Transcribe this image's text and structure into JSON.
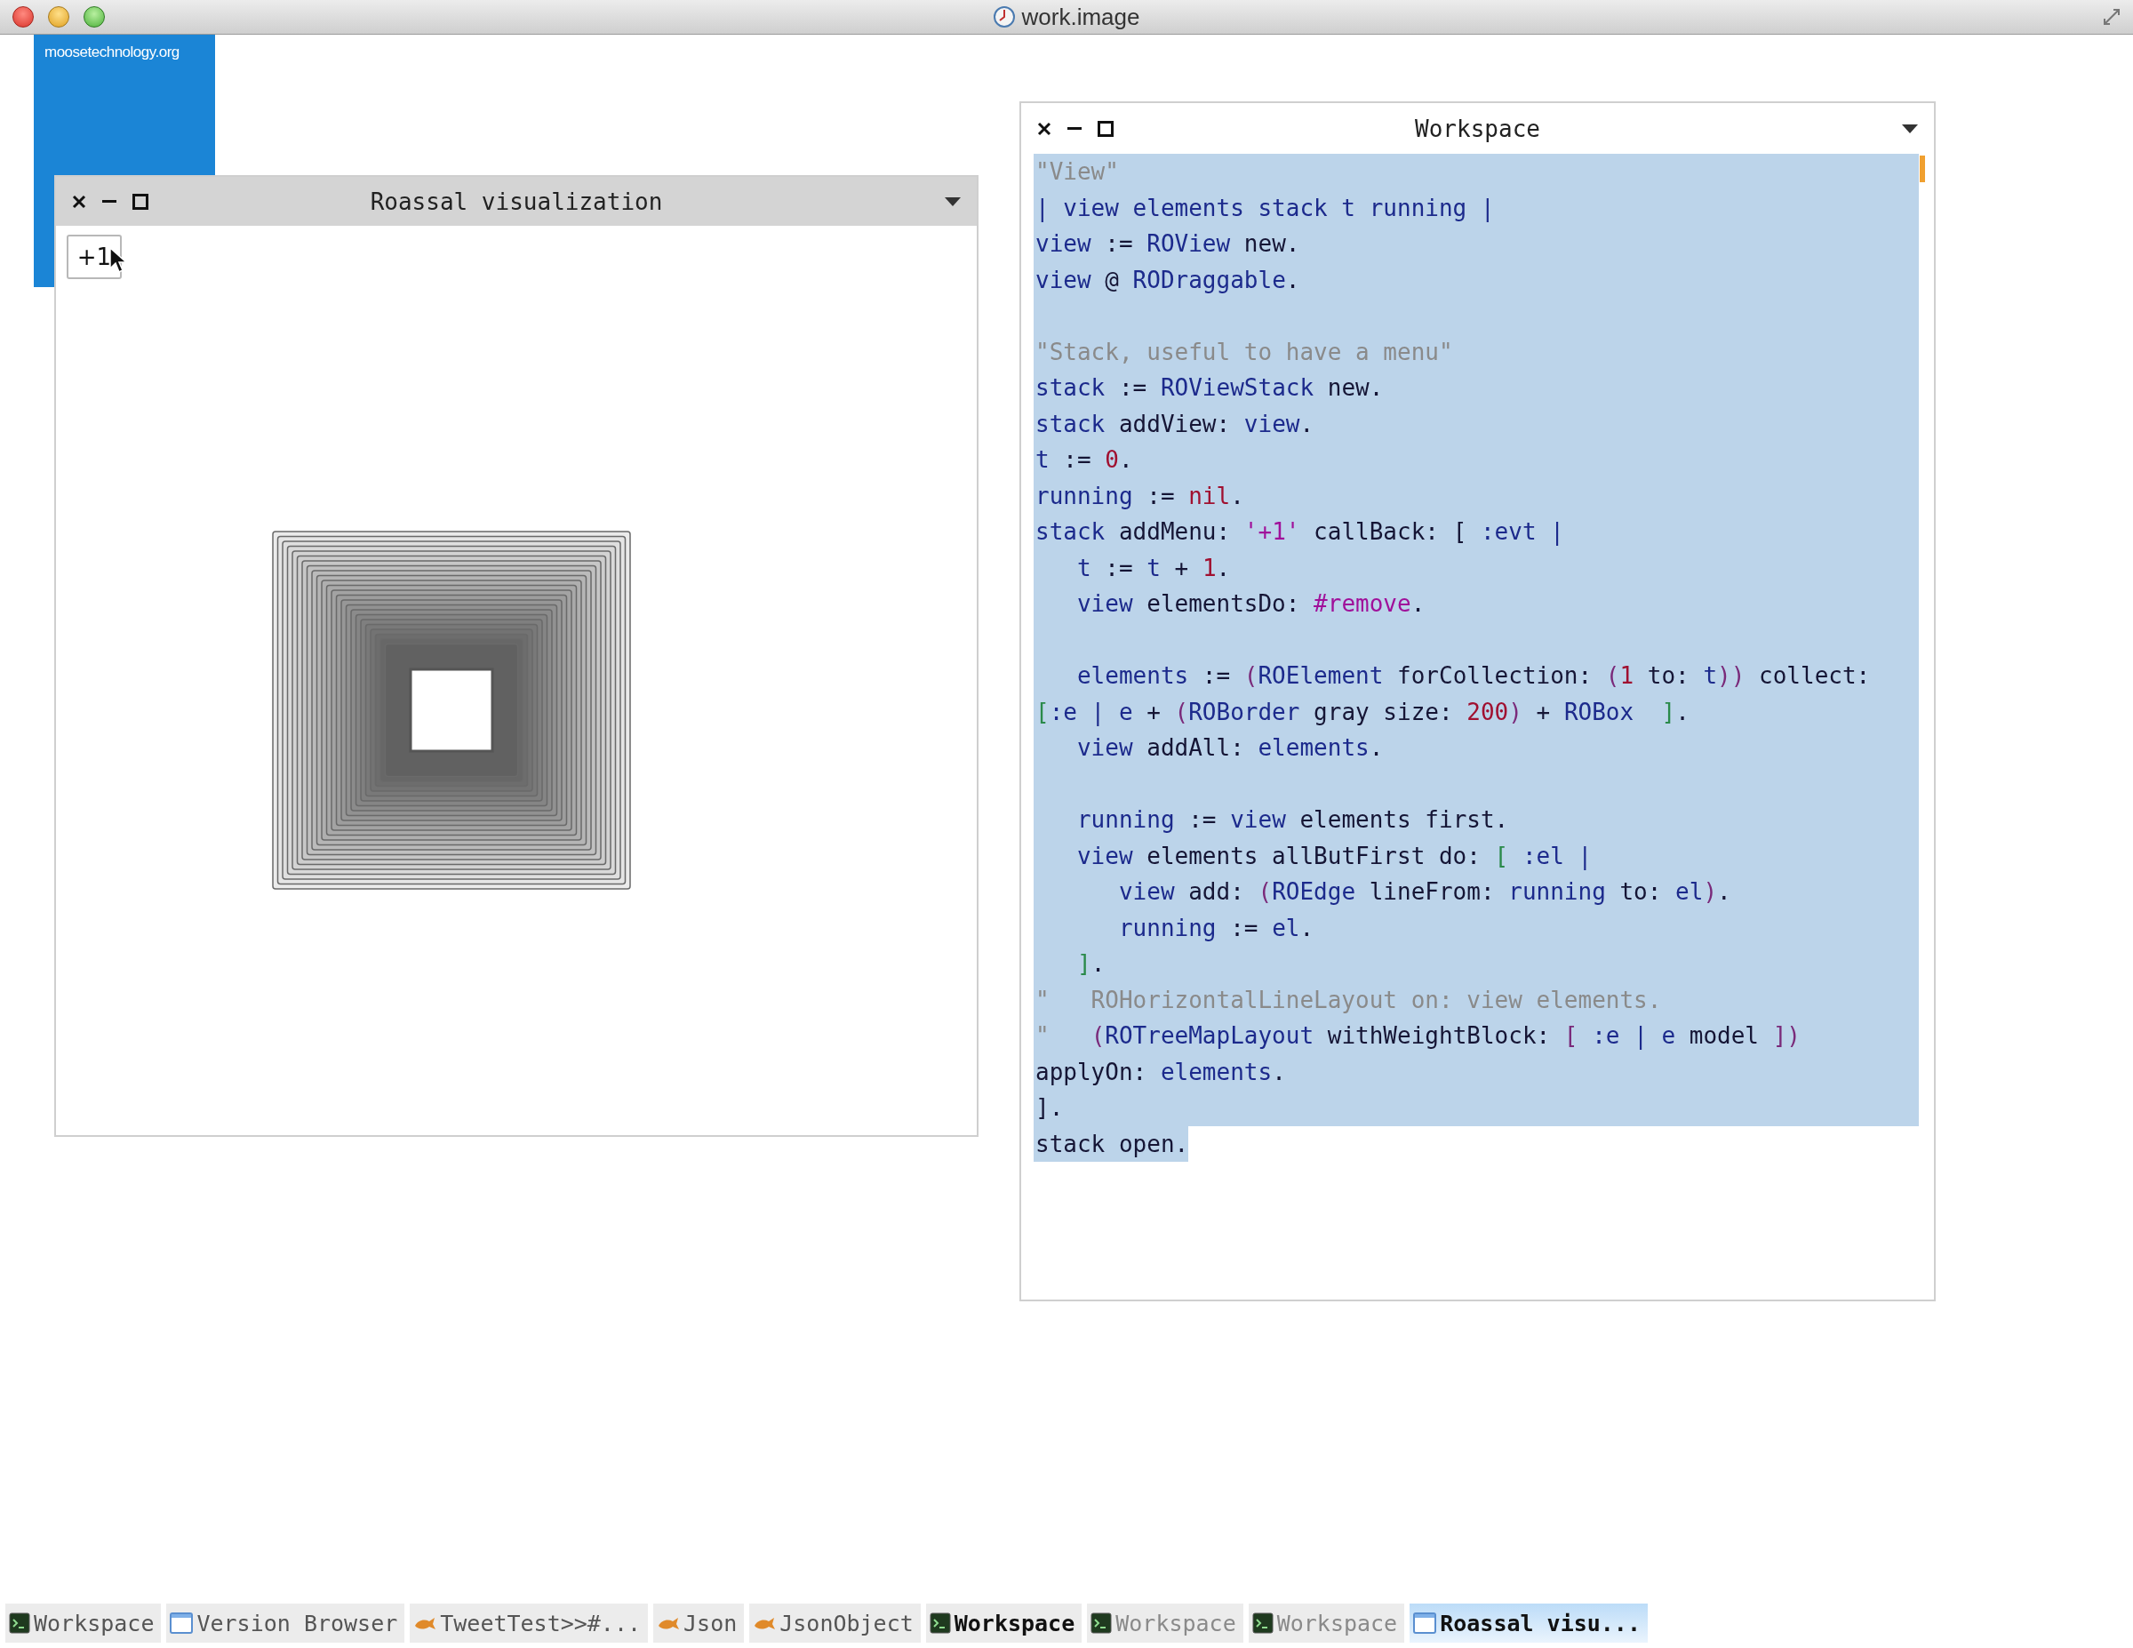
{
  "title_bar": {
    "title": "work.image"
  },
  "desktop_badge": {
    "text": "moosetechnology.org"
  },
  "roassal_window": {
    "title": "Roassal visualization",
    "menu_button": "+1"
  },
  "workspace_window": {
    "title": "Workspace",
    "lines": [
      {
        "selected": true,
        "segments": [
          {
            "kind": "comment",
            "text": "\"View\""
          }
        ]
      },
      {
        "selected": true,
        "segments": [
          {
            "kind": "var",
            "text": "| view elements stack t running |"
          }
        ]
      },
      {
        "selected": true,
        "segments": [
          {
            "kind": "var",
            "text": "view"
          },
          {
            "kind": "plain",
            "text": " := "
          },
          {
            "kind": "var",
            "text": "ROView"
          },
          {
            "kind": "plain",
            "text": " new."
          }
        ]
      },
      {
        "selected": true,
        "segments": [
          {
            "kind": "var",
            "text": "view"
          },
          {
            "kind": "plain",
            "text": " @ "
          },
          {
            "kind": "var",
            "text": "RODraggable"
          },
          {
            "kind": "plain",
            "text": "."
          }
        ]
      },
      {
        "selected": true,
        "gap_before": true,
        "segments": [
          {
            "kind": "comment",
            "text": "\"Stack, useful to have a menu\""
          }
        ]
      },
      {
        "selected": true,
        "segments": [
          {
            "kind": "var",
            "text": "stack"
          },
          {
            "kind": "plain",
            "text": " := "
          },
          {
            "kind": "var",
            "text": "ROViewStack"
          },
          {
            "kind": "plain",
            "text": " new."
          }
        ]
      },
      {
        "selected": true,
        "segments": [
          {
            "kind": "var",
            "text": "stack"
          },
          {
            "kind": "plain",
            "text": " addView: "
          },
          {
            "kind": "var",
            "text": "view"
          },
          {
            "kind": "plain",
            "text": "."
          }
        ]
      },
      {
        "selected": true,
        "segments": [
          {
            "kind": "var",
            "text": "t"
          },
          {
            "kind": "plain",
            "text": " := "
          },
          {
            "kind": "number",
            "text": "0"
          },
          {
            "kind": "plain",
            "text": "."
          }
        ]
      },
      {
        "selected": true,
        "segments": [
          {
            "kind": "var",
            "text": "running"
          },
          {
            "kind": "plain",
            "text": " := "
          },
          {
            "kind": "number",
            "text": "nil"
          },
          {
            "kind": "plain",
            "text": "."
          }
        ]
      },
      {
        "selected": true,
        "segments": [
          {
            "kind": "var",
            "text": "stack"
          },
          {
            "kind": "plain",
            "text": " addMenu: "
          },
          {
            "kind": "symbol",
            "text": "'+1'"
          },
          {
            "kind": "plain",
            "text": " callBack: [ "
          },
          {
            "kind": "var",
            "text": ":evt |"
          }
        ]
      },
      {
        "selected": true,
        "segments": [
          {
            "kind": "var",
            "text": "   t"
          },
          {
            "kind": "plain",
            "text": " := "
          },
          {
            "kind": "var",
            "text": "t"
          },
          {
            "kind": "plain",
            "text": " + "
          },
          {
            "kind": "number",
            "text": "1"
          },
          {
            "kind": "plain",
            "text": "."
          }
        ]
      },
      {
        "selected": true,
        "segments": [
          {
            "kind": "var",
            "text": "   view"
          },
          {
            "kind": "plain",
            "text": " elementsDo: "
          },
          {
            "kind": "symbol",
            "text": "#remove"
          },
          {
            "kind": "plain",
            "text": "."
          }
        ]
      },
      {
        "selected": true,
        "gap_before": true,
        "segments": [
          {
            "kind": "var",
            "text": "   elements"
          },
          {
            "kind": "plain",
            "text": " := "
          },
          {
            "kind": "paren",
            "text": "("
          },
          {
            "kind": "var",
            "text": "ROElement"
          },
          {
            "kind": "plain",
            "text": " forCollection: "
          },
          {
            "kind": "paren",
            "text": "("
          },
          {
            "kind": "number",
            "text": "1"
          },
          {
            "kind": "plain",
            "text": " to: "
          },
          {
            "kind": "var",
            "text": "t"
          },
          {
            "kind": "paren",
            "text": "))"
          },
          {
            "kind": "plain",
            "text": " collect:"
          }
        ]
      },
      {
        "selected": true,
        "segments": [
          {
            "kind": "bracket",
            "text": "["
          },
          {
            "kind": "var",
            "text": ":e | e"
          },
          {
            "kind": "plain",
            "text": " + "
          },
          {
            "kind": "paren",
            "text": "("
          },
          {
            "kind": "var",
            "text": "ROBorder"
          },
          {
            "kind": "plain",
            "text": " gray size: "
          },
          {
            "kind": "number",
            "text": "200"
          },
          {
            "kind": "paren",
            "text": ")"
          },
          {
            "kind": "plain",
            "text": " + "
          },
          {
            "kind": "var",
            "text": "ROBox"
          },
          {
            "kind": "bracket",
            "text": "  ]"
          },
          {
            "kind": "plain",
            "text": "."
          }
        ]
      },
      {
        "selected": true,
        "segments": [
          {
            "kind": "var",
            "text": "   view"
          },
          {
            "kind": "plain",
            "text": " addAll: "
          },
          {
            "kind": "var",
            "text": "elements"
          },
          {
            "kind": "plain",
            "text": "."
          }
        ]
      },
      {
        "selected": true,
        "gap_before": true,
        "segments": [
          {
            "kind": "var",
            "text": "   running"
          },
          {
            "kind": "plain",
            "text": " := "
          },
          {
            "kind": "var",
            "text": "view"
          },
          {
            "kind": "plain",
            "text": " elements first."
          }
        ]
      },
      {
        "selected": true,
        "segments": [
          {
            "kind": "var",
            "text": "   view"
          },
          {
            "kind": "plain",
            "text": " elements allButFirst do: "
          },
          {
            "kind": "bracket",
            "text": "["
          },
          {
            "kind": "var",
            "text": " :el |"
          }
        ]
      },
      {
        "selected": true,
        "segments": [
          {
            "kind": "var",
            "text": "      view"
          },
          {
            "kind": "plain",
            "text": " add: "
          },
          {
            "kind": "paren",
            "text": "("
          },
          {
            "kind": "var",
            "text": "ROEdge"
          },
          {
            "kind": "plain",
            "text": " lineFrom: "
          },
          {
            "kind": "var",
            "text": "running"
          },
          {
            "kind": "plain",
            "text": " to: "
          },
          {
            "kind": "var",
            "text": "el"
          },
          {
            "kind": "paren",
            "text": ")"
          },
          {
            "kind": "plain",
            "text": "."
          }
        ]
      },
      {
        "selected": true,
        "segments": [
          {
            "kind": "var",
            "text": "      running"
          },
          {
            "kind": "plain",
            "text": " := "
          },
          {
            "kind": "var",
            "text": "el"
          },
          {
            "kind": "plain",
            "text": "."
          }
        ]
      },
      {
        "selected": true,
        "segments": [
          {
            "kind": "bracket",
            "text": "   ]"
          },
          {
            "kind": "plain",
            "text": "."
          }
        ]
      },
      {
        "selected": true,
        "segments": [
          {
            "kind": "comment",
            "text": "\"   ROHorizontalLineLayout on: view elements."
          }
        ]
      },
      {
        "selected": true,
        "segments": [
          {
            "kind": "comment",
            "text": "\"   "
          },
          {
            "kind": "paren",
            "text": "("
          },
          {
            "kind": "var",
            "text": "ROTreeMapLayout"
          },
          {
            "kind": "plain",
            "text": " withWeightBlock: "
          },
          {
            "kind": "paren",
            "text": "["
          },
          {
            "kind": "var",
            "text": " :e | e"
          },
          {
            "kind": "plain",
            "text": " model "
          },
          {
            "kind": "paren",
            "text": "])"
          }
        ]
      },
      {
        "selected": true,
        "segments": [
          {
            "kind": "plain",
            "text": "applyOn: "
          },
          {
            "kind": "var",
            "text": "elements"
          },
          {
            "kind": "plain",
            "text": "."
          }
        ]
      },
      {
        "selected": true,
        "segments": [
          {
            "kind": "plain",
            "text": "]."
          }
        ]
      },
      {
        "selected": true,
        "segments": [
          {
            "kind": "plain",
            "text": "stack open."
          }
        ]
      }
    ]
  },
  "taskbar": [
    {
      "label": "Workspace",
      "kind": "terminal",
      "selected": false
    },
    {
      "label": "Version Browser",
      "kind": "window",
      "selected": false
    },
    {
      "label": "TweetTest>>#...",
      "kind": "tool",
      "selected": false
    },
    {
      "label": "Json",
      "kind": "tool",
      "selected": false
    },
    {
      "label": "JsonObject",
      "kind": "tool",
      "selected": false
    },
    {
      "label": "Workspace",
      "kind": "terminal",
      "selected": false,
      "bold": true
    },
    {
      "label": "Workspace",
      "kind": "terminal",
      "selected": false,
      "dimmed": true
    },
    {
      "label": "Workspace",
      "kind": "terminal",
      "selected": false,
      "dimmed": true
    },
    {
      "label": "Roassal visu...",
      "kind": "window",
      "selected": true,
      "bold": true
    }
  ]
}
